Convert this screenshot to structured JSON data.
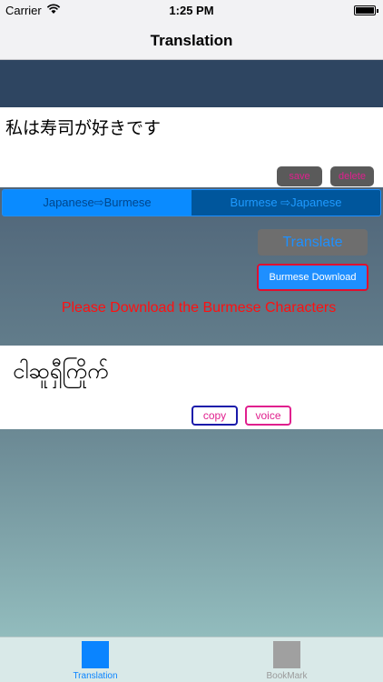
{
  "status_bar": {
    "carrier": "Carrier",
    "time": "1:25 PM"
  },
  "nav": {
    "title": "Translation"
  },
  "input": {
    "text": "私は寿司が好きです"
  },
  "input_buttons": {
    "save": "save",
    "delete": "delete"
  },
  "segments": [
    {
      "label": "Japanese⇨Burmese",
      "selected": true
    },
    {
      "label": "Burmese ⇨Japanese",
      "selected": false
    }
  ],
  "actions": {
    "translate": "Translate",
    "download": "Burmese Download"
  },
  "warning": "Please Download the Burmese Characters",
  "output": {
    "text": "ငါဆူရှီကြိုက်"
  },
  "output_buttons": {
    "copy": "copy",
    "voice": "voice"
  },
  "tabs": [
    {
      "label": "Translation",
      "icon": "square-icon",
      "active": true
    },
    {
      "label": "BookMark",
      "icon": "square-icon",
      "active": false
    }
  ],
  "colors": {
    "accent": "#0A84FF",
    "header_band": "#2E4561",
    "warning": "#FF1010",
    "button_text_pink": "#E0208E"
  }
}
